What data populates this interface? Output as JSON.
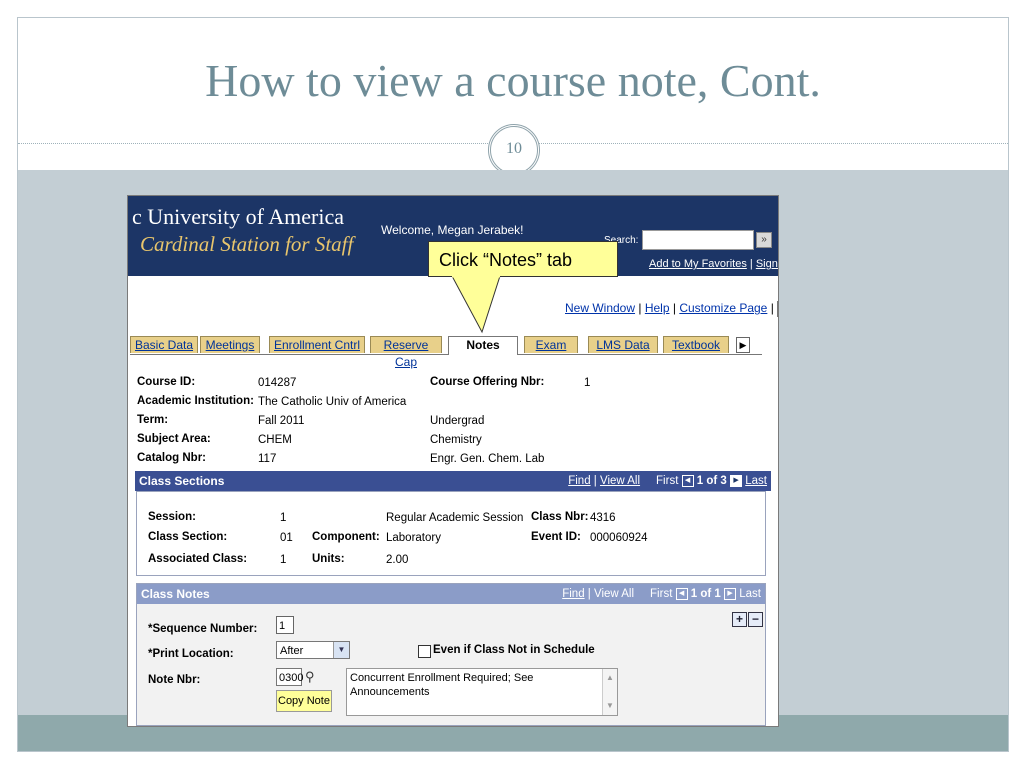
{
  "slide": {
    "title": "How to view a course note, Cont.",
    "number": "10"
  },
  "header": {
    "university": "c University of America",
    "portal": "Cardinal Station for Staff",
    "welcome": "Welcome, Megan Jerabek!",
    "search_label": "Search:",
    "links": [
      "Add to My Favorites",
      "Sign o"
    ]
  },
  "callout": {
    "text": "Click “Notes” tab"
  },
  "utility_links": [
    "New Window",
    "Help",
    "Customize Page"
  ],
  "http_icon": "http",
  "tabs": [
    {
      "label": "Basic Data",
      "active": false
    },
    {
      "label": "Meetings",
      "active": false
    },
    {
      "label": "Enrollment Cntrl",
      "active": false
    },
    {
      "label": "Reserve Cap",
      "active": false
    },
    {
      "label": "Notes",
      "active": true
    },
    {
      "label": "Exam",
      "active": false
    },
    {
      "label": "LMS Data",
      "active": false
    },
    {
      "label": "Textbook",
      "active": false
    }
  ],
  "course": {
    "course_id_label": "Course ID:",
    "course_id": "014287",
    "offering_label": "Course Offering Nbr:",
    "offering": "1",
    "institution_label": "Academic Institution:",
    "institution": "The Catholic Univ of America",
    "term_label": "Term:",
    "term": "Fall 2011",
    "career": "Undergrad",
    "subject_label": "Subject Area:",
    "subject": "CHEM",
    "subject_desc": "Chemistry",
    "catalog_label": "Catalog Nbr:",
    "catalog": "117",
    "catalog_desc": "Engr. Gen. Chem. Lab"
  },
  "class_sections": {
    "title": "Class Sections",
    "find": "Find",
    "view_all": "View All",
    "first": "First",
    "counter": "1 of 3",
    "last": "Last",
    "session_label": "Session:",
    "session": "1",
    "session_desc": "Regular Academic Session",
    "class_nbr_label": "Class Nbr:",
    "class_nbr": "4316",
    "section_label": "Class Section:",
    "section": "01",
    "component_label": "Component:",
    "component": "Laboratory",
    "event_label": "Event ID:",
    "event": "000060924",
    "assoc_label": "Associated Class:",
    "assoc": "1",
    "units_label": "Units:",
    "units": "2.00"
  },
  "class_notes": {
    "title": "Class Notes",
    "find": "Find",
    "view_all": "View All",
    "first": "First",
    "counter": "1 of 1",
    "last": "Last",
    "seq_label": "*Sequence Number:",
    "seq": "1",
    "print_label": "*Print Location:",
    "print_value": "After",
    "checkbox_label": "Even if Class Not in Schedule",
    "note_nbr_label": "Note Nbr:",
    "note_nbr": "0300",
    "copy_button": "Copy Note",
    "note_text": "Concurrent Enrollment Required; See Announcements"
  }
}
